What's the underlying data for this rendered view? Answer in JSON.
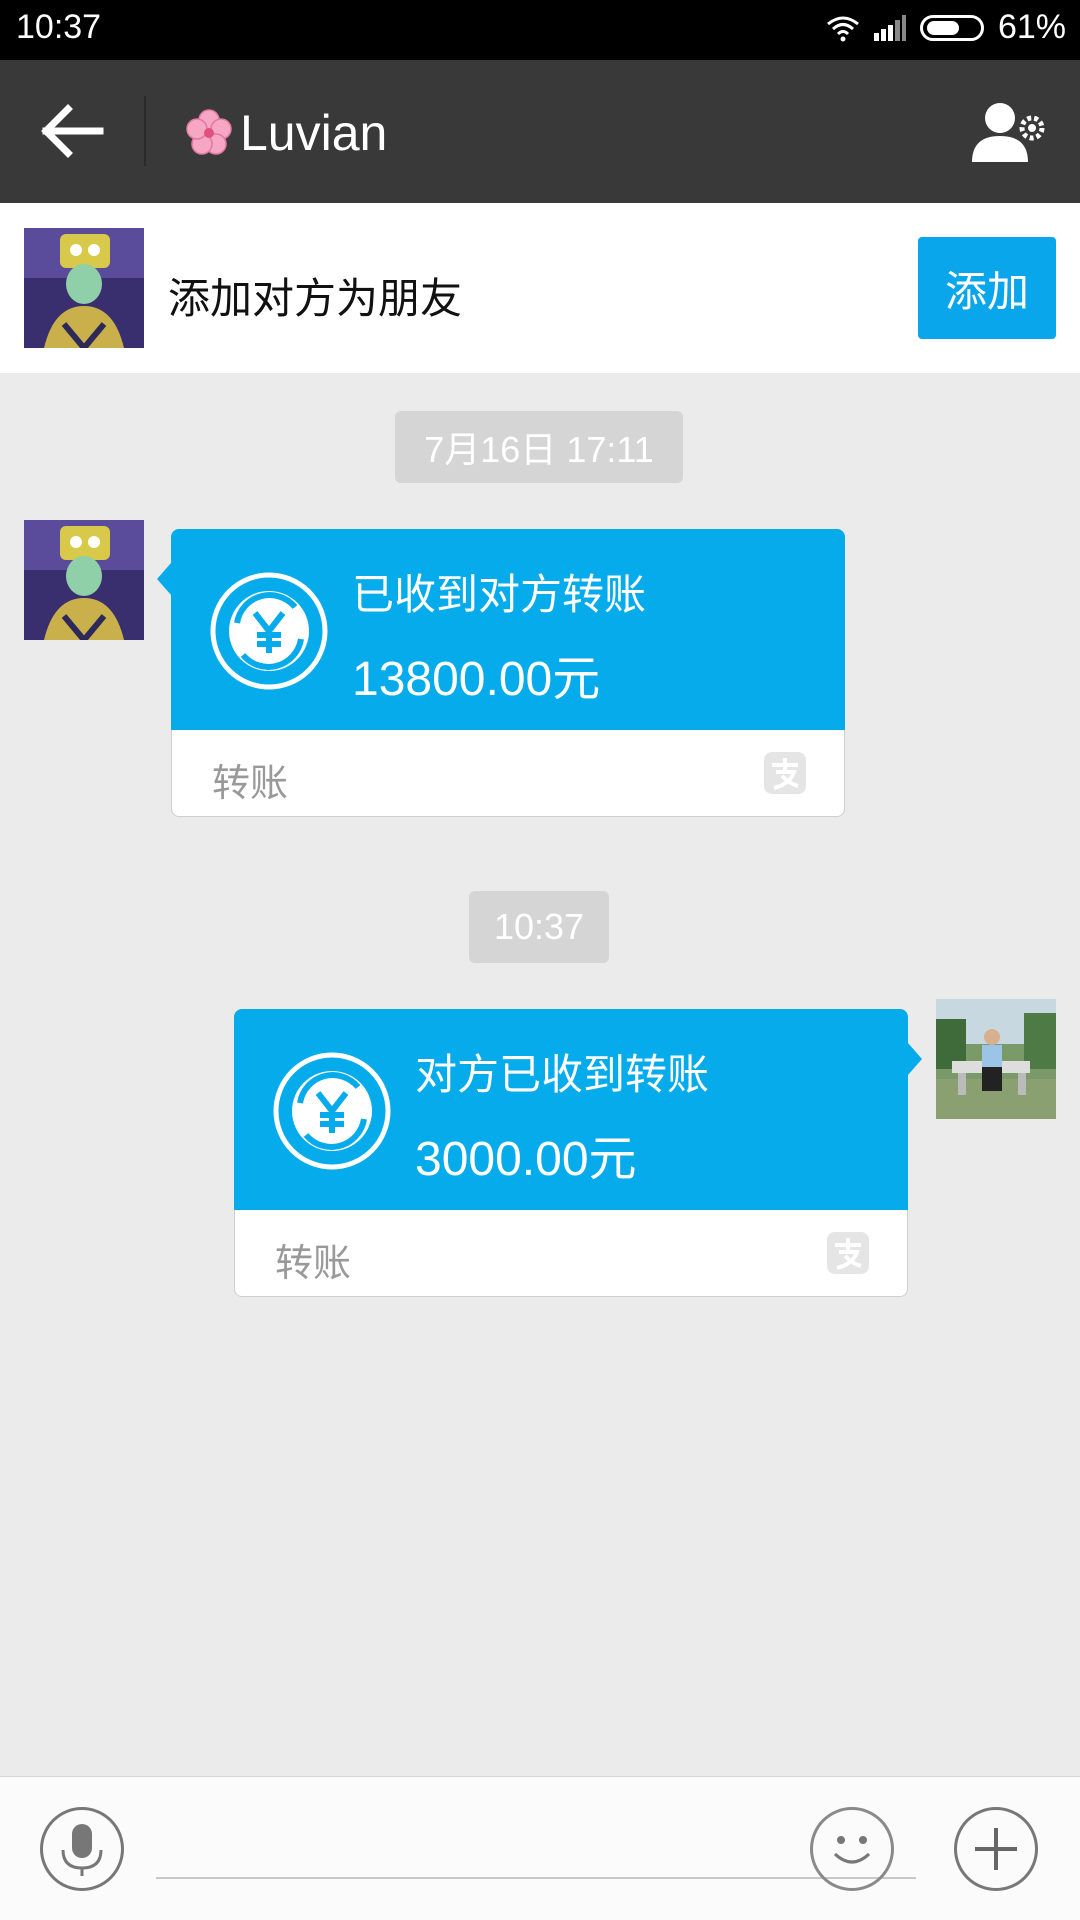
{
  "status_bar": {
    "time": "10:37",
    "battery": "61%",
    "battery_level": 0.61
  },
  "header": {
    "title": "Luvian",
    "back_icon": "back-arrow-icon",
    "settings_icon": "user-settings-icon"
  },
  "add_friend": {
    "prompt": "添加对方为朋友",
    "button_label": "添加"
  },
  "messages": [
    {
      "timestamp": "7月16日 17:11",
      "direction": "incoming",
      "title": "已收到对方转账",
      "amount": "13800.00元",
      "type_label": "转账",
      "icon": "transfer-yen-icon",
      "badge_icon": "alipay-icon"
    },
    {
      "timestamp": "10:37",
      "direction": "outgoing",
      "title": "对方已收到转账",
      "amount": "3000.00元",
      "type_label": "转账",
      "icon": "transfer-yen-icon",
      "badge_icon": "alipay-icon"
    }
  ],
  "input_bar": {
    "voice_icon": "microphone-icon",
    "emoji_icon": "smiley-icon",
    "more_icon": "plus-icon",
    "placeholder": ""
  },
  "colors": {
    "accent": "#06abeb",
    "title_bar": "#393939",
    "background": "#ebebeb"
  }
}
